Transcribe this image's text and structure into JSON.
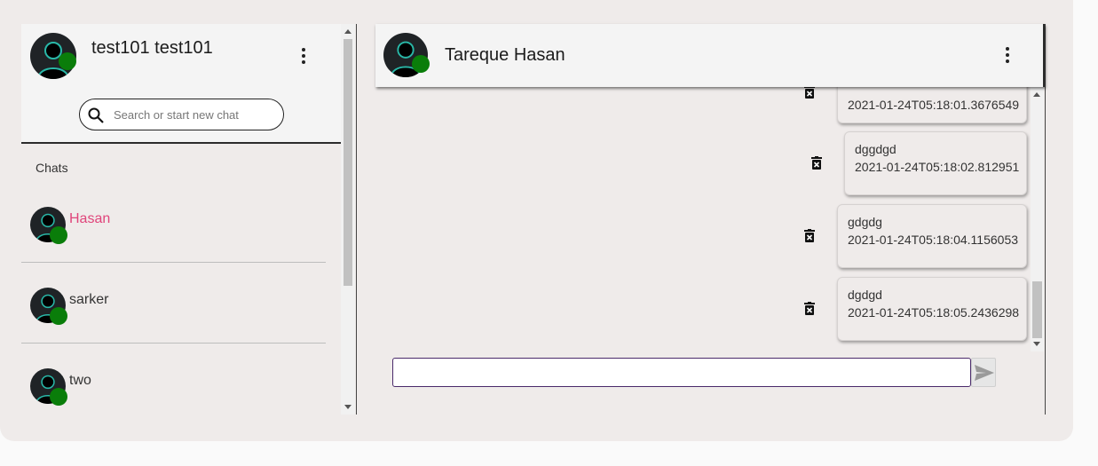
{
  "current_user": {
    "name": "test101 test101",
    "avatar_icon": "user-avatar-icon",
    "status_color": "#0a7d0a"
  },
  "search": {
    "placeholder": "Search or start new chat"
  },
  "chats": {
    "title": "Chats",
    "items": [
      {
        "name": "Hasan",
        "active": true
      },
      {
        "name": "sarker",
        "active": false
      },
      {
        "name": "two",
        "active": false
      }
    ]
  },
  "conversation": {
    "peer_name": "Tareque Hasan",
    "messages": [
      {
        "text": "",
        "time": "2021-01-24T05:18:01.3676549"
      },
      {
        "text": "dggdgd",
        "time": "2021-01-24T05:18:02.812951"
      },
      {
        "text": "gdgdg",
        "time": "2021-01-24T05:18:04.1156053"
      },
      {
        "text": "dgdgd",
        "time": "2021-01-24T05:18:05.2436298"
      }
    ]
  },
  "composer": {
    "value": "",
    "send_icon": "send-icon"
  },
  "colors": {
    "active_chat": "#e0457b",
    "accent_border": "#4a2a6a",
    "background": "#efebea"
  }
}
